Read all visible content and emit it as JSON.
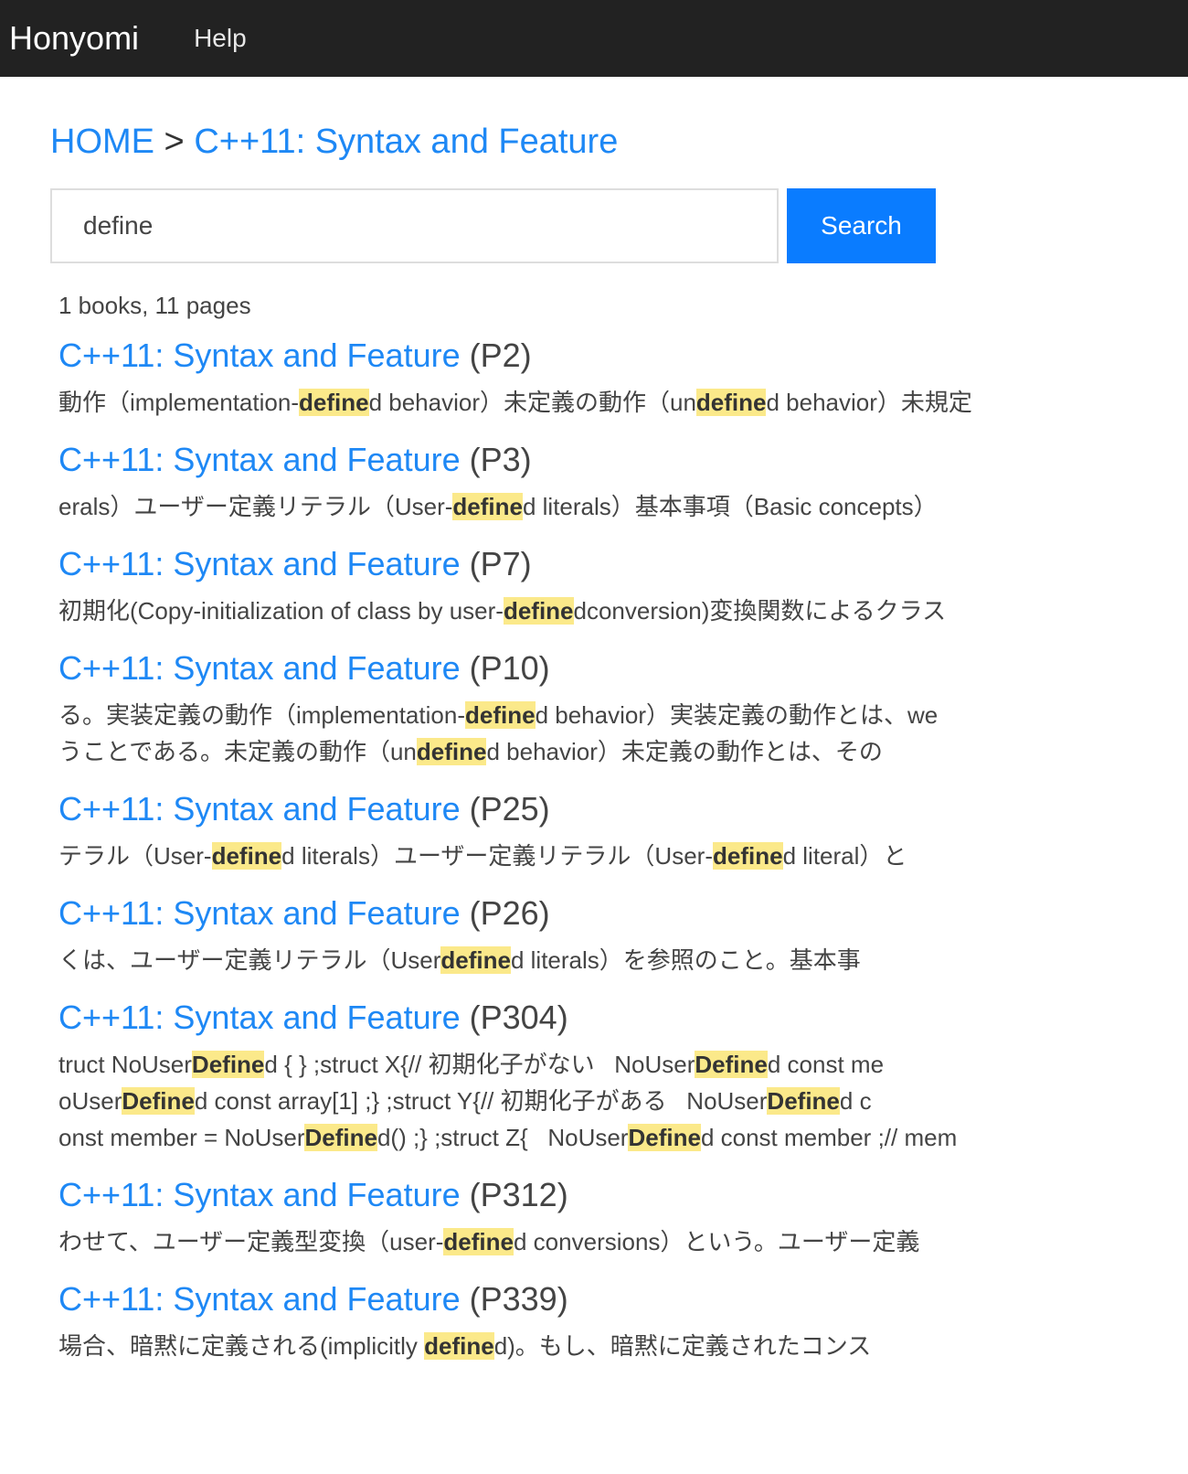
{
  "nav": {
    "brand": "Honyomi",
    "help": "Help"
  },
  "breadcrumb": {
    "home": "HOME",
    "sep": " > ",
    "book": "C++11: Syntax and Feature"
  },
  "search": {
    "value": "define",
    "button": "Search"
  },
  "summary": "1 books, 11 pages",
  "colors": {
    "link": "#1e88f5",
    "button": "#0a7cff",
    "highlight": "#fbe98a",
    "header": "#222222"
  },
  "results": [
    {
      "title": "C++11: Syntax and Feature",
      "page": "(P2)",
      "lines": [
        [
          {
            "t": "動作（implementation-"
          },
          {
            "t": "define",
            "hl": true
          },
          {
            "t": "d behavior）未定義の動作（un"
          },
          {
            "t": "define",
            "hl": true
          },
          {
            "t": "d behavior）未規定"
          }
        ]
      ]
    },
    {
      "title": "C++11: Syntax and Feature",
      "page": "(P3)",
      "lines": [
        [
          {
            "t": "erals）ユーザー定義リテラル（User-"
          },
          {
            "t": "define",
            "hl": true
          },
          {
            "t": "d literals）基本事項（Basic concepts）"
          }
        ]
      ]
    },
    {
      "title": "C++11: Syntax and Feature",
      "page": "(P7)",
      "lines": [
        [
          {
            "t": "初期化(Copy-initialization of class by user-"
          },
          {
            "t": "define",
            "hl": true
          },
          {
            "t": "dconversion)変換関数によるクラス"
          }
        ]
      ]
    },
    {
      "title": "C++11: Syntax and Feature",
      "page": "(P10)",
      "lines": [
        [
          {
            "t": "る。実装定義の動作（implementation-"
          },
          {
            "t": "define",
            "hl": true
          },
          {
            "t": "d behavior）実装定義の動作とは、we"
          }
        ],
        [
          {
            "t": "うことである。未定義の動作（un"
          },
          {
            "t": "define",
            "hl": true
          },
          {
            "t": "d behavior）未定義の動作とは、その"
          }
        ]
      ]
    },
    {
      "title": "C++11: Syntax and Feature",
      "page": "(P25)",
      "lines": [
        [
          {
            "t": "テラル（User-"
          },
          {
            "t": "define",
            "hl": true
          },
          {
            "t": "d literals）ユーザー定義リテラル（User-"
          },
          {
            "t": "define",
            "hl": true
          },
          {
            "t": "d literal）と"
          }
        ]
      ]
    },
    {
      "title": "C++11: Syntax and Feature",
      "page": "(P26)",
      "lines": [
        [
          {
            "t": "くは、ユーザー定義リテラル（User"
          },
          {
            "t": "define",
            "hl": true
          },
          {
            "t": "d literals）を参照のこと。基本事"
          }
        ]
      ]
    },
    {
      "title": "C++11: Syntax and Feature",
      "page": "(P304)",
      "lines": [
        [
          {
            "t": "truct NoUser"
          },
          {
            "t": "Define",
            "hl": true
          },
          {
            "t": "d { } ;struct X{// 初期化子がない   NoUser"
          },
          {
            "t": "Define",
            "hl": true
          },
          {
            "t": "d const me"
          }
        ],
        [
          {
            "t": "oUser"
          },
          {
            "t": "Define",
            "hl": true
          },
          {
            "t": "d const array[1] ;} ;struct Y{// 初期化子がある   NoUser"
          },
          {
            "t": "Define",
            "hl": true
          },
          {
            "t": "d c"
          }
        ],
        [
          {
            "t": "onst member = NoUser"
          },
          {
            "t": "Define",
            "hl": true
          },
          {
            "t": "d() ;} ;struct Z{   NoUser"
          },
          {
            "t": "Define",
            "hl": true
          },
          {
            "t": "d const member ;// mem"
          }
        ]
      ]
    },
    {
      "title": "C++11: Syntax and Feature",
      "page": "(P312)",
      "lines": [
        [
          {
            "t": "わせて、ユーザー定義型変換（user-"
          },
          {
            "t": "define",
            "hl": true
          },
          {
            "t": "d conversions）という。ユーザー定義"
          }
        ]
      ]
    },
    {
      "title": "C++11: Syntax and Feature",
      "page": "(P339)",
      "lines": [
        [
          {
            "t": "場合、暗黙に定義される(implicitly "
          },
          {
            "t": "define",
            "hl": true
          },
          {
            "t": "d)。もし、暗黙に定義されたコンス"
          }
        ]
      ]
    }
  ]
}
